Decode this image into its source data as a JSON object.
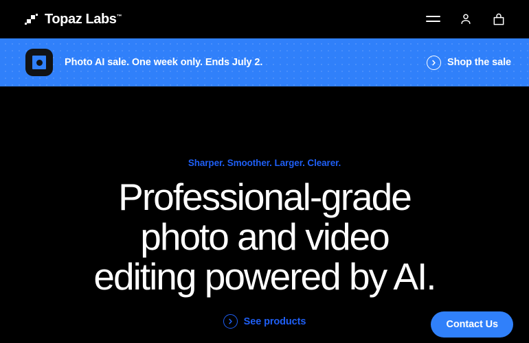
{
  "colors": {
    "background": "#000000",
    "accent_blue": "#3080fa",
    "link_blue": "#1f5ff5",
    "text_white": "#ffffff",
    "icon_dark": "#111214"
  },
  "header": {
    "brand_name": "Topaz Labs",
    "brand_trademark": "™",
    "brand_mark_icon": "stair-squares-logo-icon",
    "nav_icons": [
      {
        "name": "menu-icon",
        "label": "Menu"
      },
      {
        "name": "account-icon",
        "label": "Account"
      },
      {
        "name": "shopping-bag-icon",
        "label": "Cart"
      }
    ]
  },
  "promo": {
    "app_icon": "photo-ai-app-icon",
    "message": "Photo AI sale. One week only. Ends July 2.",
    "cta_label": "Shop the sale",
    "cta_icon": "chevron-right-circle-icon"
  },
  "hero": {
    "eyebrow": "Sharper. Smoother. Larger. Clearer.",
    "headline_lines": [
      "Professional-grade",
      "photo and video",
      "editing powered by AI."
    ],
    "cta_label": "See products",
    "cta_icon": "chevron-right-circle-icon"
  },
  "contact": {
    "label": "Contact Us"
  }
}
